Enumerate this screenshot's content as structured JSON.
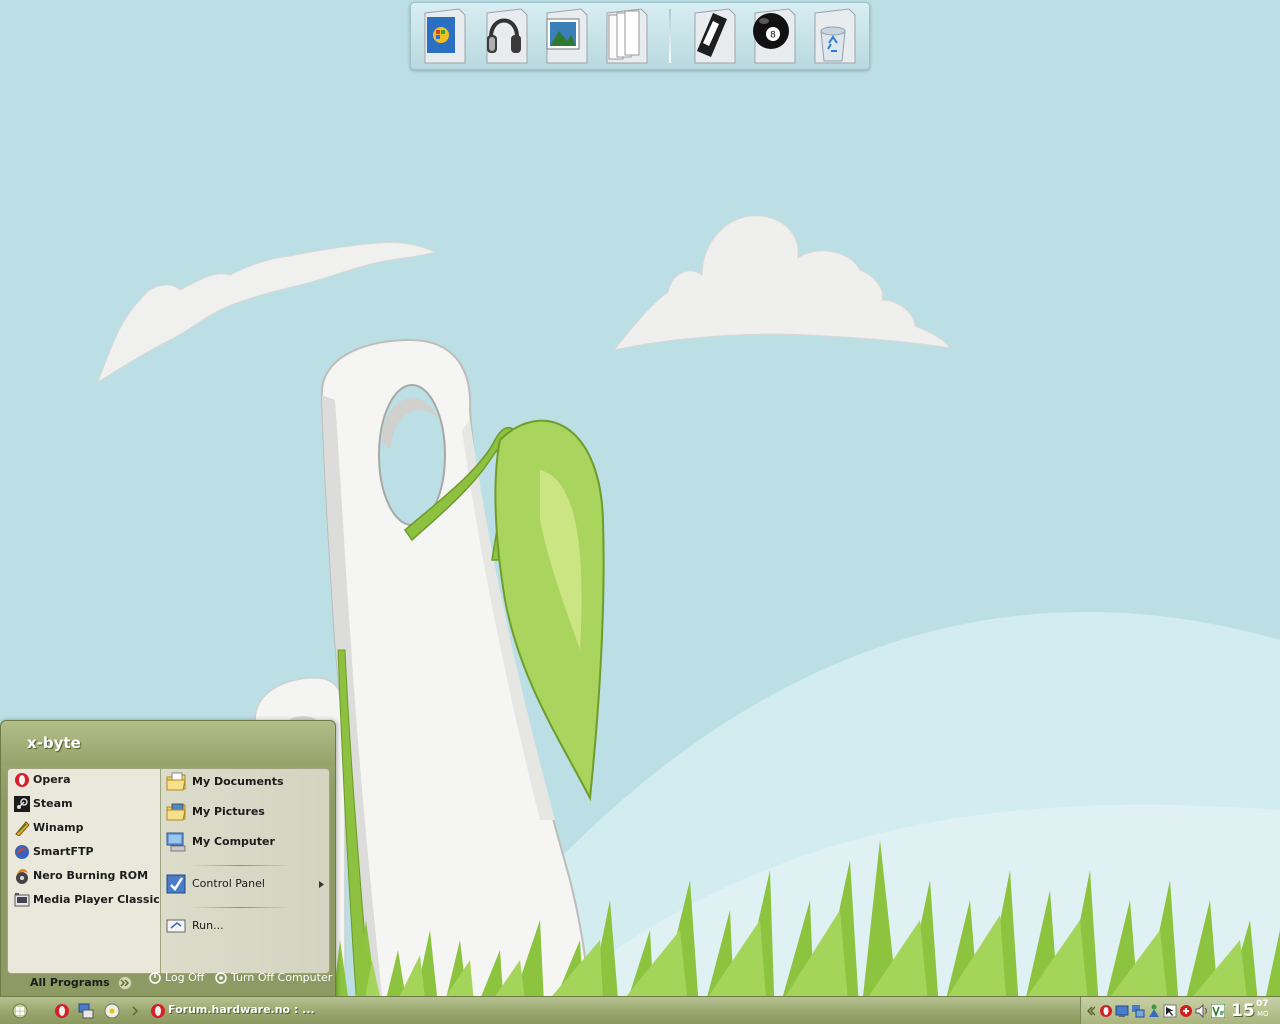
{
  "colors": {
    "sky": "#bcdfe5",
    "hill": "#d3ecf0",
    "grass": "#8cc43f",
    "menu_olive": "#95a26a",
    "taskbar_olive": "#98a56d"
  },
  "dock": {
    "items": [
      {
        "icon": "windows-folder-icon"
      },
      {
        "icon": "headphones-folder-icon"
      },
      {
        "icon": "pictures-folder-icon"
      },
      {
        "icon": "documents-folder-icon"
      },
      {
        "icon": "video-cassette-folder-icon"
      },
      {
        "icon": "eight-ball-folder-icon"
      },
      {
        "icon": "recycle-bin-icon"
      }
    ],
    "eight_ball_number": "8"
  },
  "start_menu": {
    "user_name": "x-byte",
    "pinned": [
      {
        "label": "Opera",
        "icon": "opera-icon"
      },
      {
        "label": "Steam",
        "icon": "steam-icon"
      },
      {
        "label": "Winamp",
        "icon": "winamp-icon"
      },
      {
        "label": "SmartFTP",
        "icon": "smartftp-icon"
      },
      {
        "label": "Nero Burning ROM",
        "icon": "nero-icon"
      },
      {
        "label": "Media Player Classic",
        "icon": "media-player-classic-icon"
      }
    ],
    "all_programs_label": "All Programs",
    "places": [
      {
        "label": "My Documents",
        "icon": "my-documents-icon"
      },
      {
        "label": "My Pictures",
        "icon": "my-pictures-icon"
      },
      {
        "label": "My Computer",
        "icon": "my-computer-icon"
      }
    ],
    "control_panel_label": "Control Panel",
    "run_label": "Run...",
    "log_off_label": "Log Off",
    "turn_off_label": "Turn Off Computer"
  },
  "taskbar": {
    "quick_launch": [
      "opera-icon",
      "network-icon",
      "media-icon"
    ],
    "task_label": "Forum.hardware.no : ...",
    "clock": {
      "hour": "15",
      "minute": "07",
      "day": "MO"
    }
  }
}
